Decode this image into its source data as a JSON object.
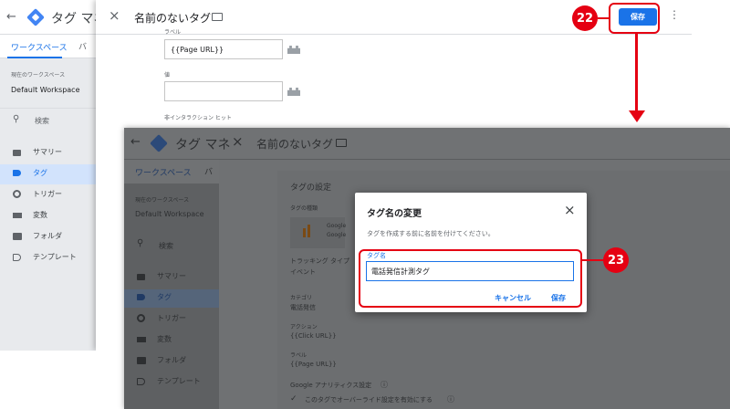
{
  "back": {
    "app_title": "タグ マネ",
    "tab_workspace": "ワークスペース",
    "tab_version": "バ",
    "workspace_caption": "現在のワークスペース",
    "workspace_name": "Default Workspace",
    "search": "検索",
    "nav": [
      {
        "label": "サマリー",
        "icon": "summary-icon"
      },
      {
        "label": "タグ",
        "icon": "tag-icon"
      },
      {
        "label": "トリガー",
        "icon": "trigger-icon"
      },
      {
        "label": "変数",
        "icon": "variables-icon"
      },
      {
        "label": "フォルダ",
        "icon": "folder-icon"
      },
      {
        "label": "テンプレート",
        "icon": "template-icon"
      }
    ],
    "panel_title": "名前のないタグ",
    "save": "保存",
    "field1_label": "ラベル",
    "field1_value": "{{Page URL}}",
    "field2_label": "値",
    "field2_value": "",
    "field3_label": "非インタラクション ヒット"
  },
  "front": {
    "app_title": "タグ マネ",
    "tab_workspace": "ワークスペース",
    "tab_version": "バ",
    "workspace_caption": "現在のワークスペース",
    "workspace_name": "Default Workspace",
    "search": "検索",
    "nav": [
      {
        "label": "サマリー",
        "icon": "summary-icon"
      },
      {
        "label": "タグ",
        "icon": "tag-icon"
      },
      {
        "label": "トリガー",
        "icon": "trigger-icon"
      },
      {
        "label": "変数",
        "icon": "variables-icon"
      },
      {
        "label": "フォルダ",
        "icon": "folder-icon"
      },
      {
        "label": "テンプレート",
        "icon": "template-icon"
      }
    ],
    "panel_title": "名前のないタグ",
    "section_title": "タグの設定",
    "tag_type_label": "タグの種類",
    "tag_type_value": "Google",
    "tag_type_value2": "Google",
    "tracking_label": "トラッキング タイプ",
    "tracking_value": "イベント",
    "category_label": "カテゴリ",
    "category_value": "電話発信",
    "action_label": "アクション",
    "action_value": "{{Click URL}}",
    "label_label": "ラベル",
    "label_value": "{{Page URL}}",
    "ga_settings": "Google アナリティクス設定",
    "override_checkbox": "このタグでオーバーライド設定を有効にする"
  },
  "dialog": {
    "title": "タグ名の変更",
    "subtitle": "タグを作成する前に名前を付けてください。",
    "field_label": "タグ名",
    "field_value": "電話発信計測タグ",
    "cancel": "キャンセル",
    "save": "保存"
  },
  "annotations": {
    "step22": "22",
    "step23": "23",
    "accent": "#e50012"
  }
}
